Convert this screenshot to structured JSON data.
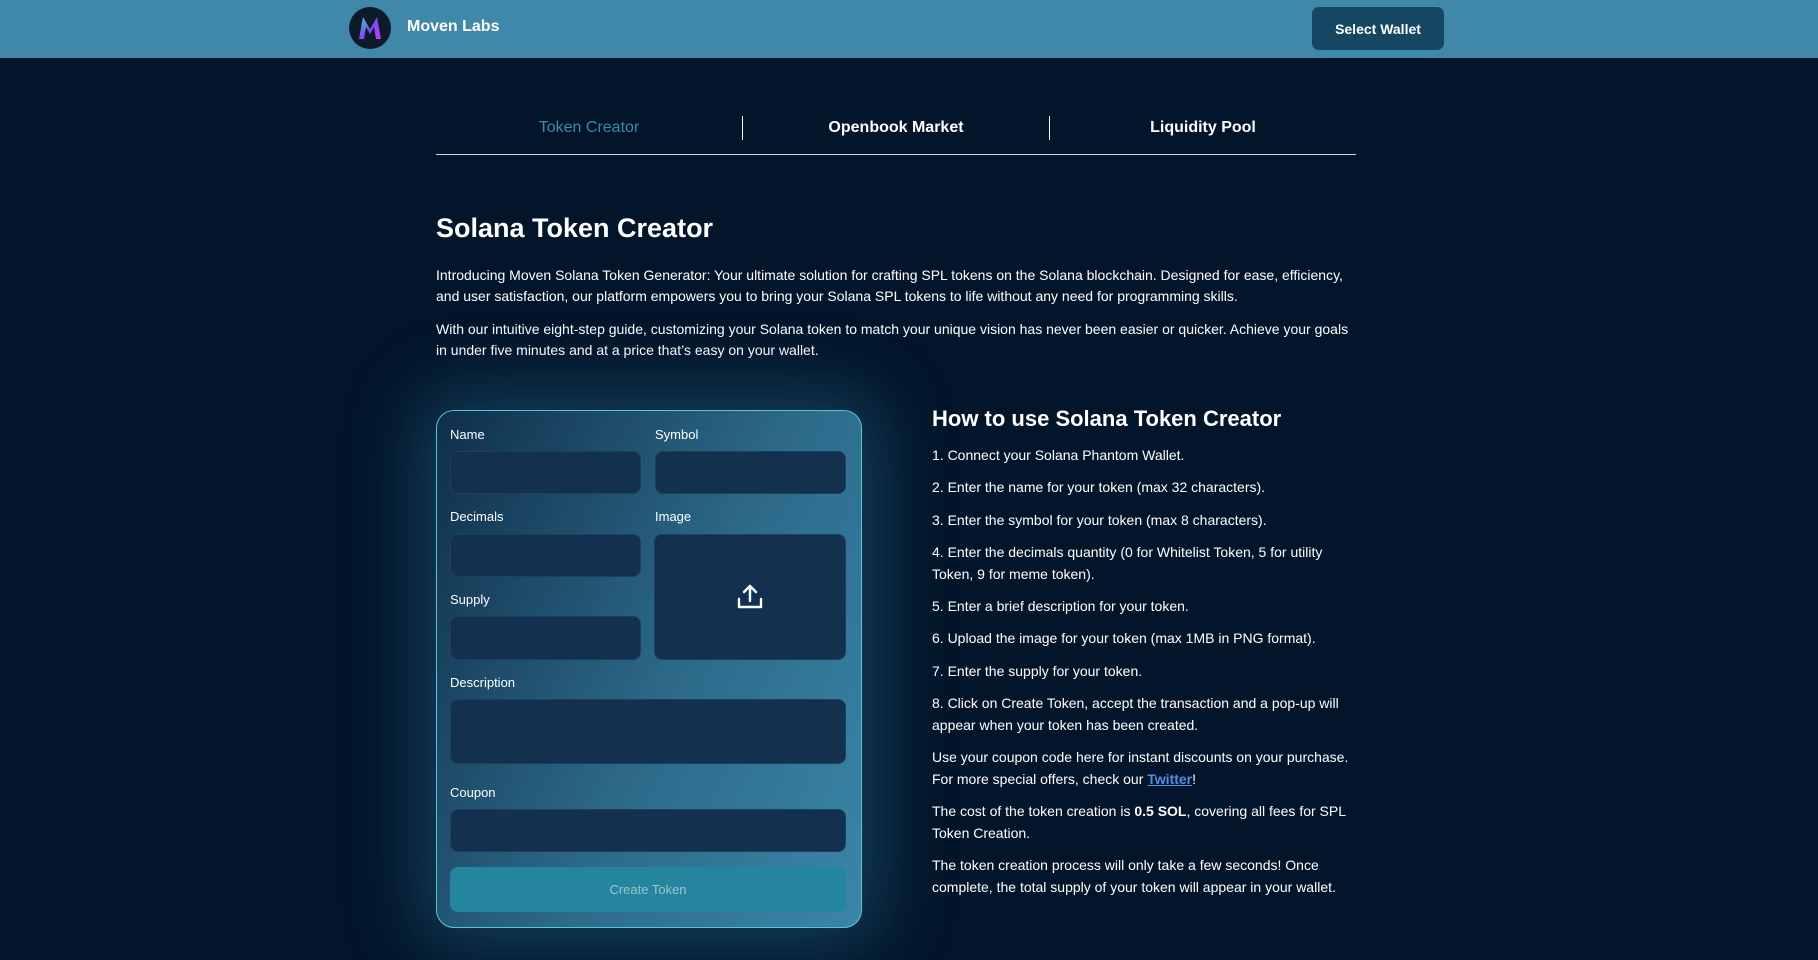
{
  "header": {
    "logo_letter": "M",
    "brand": "Moven Labs",
    "wallet_button": "Select Wallet"
  },
  "tabs": [
    {
      "label": "Token Creator",
      "active": true
    },
    {
      "label": "Openbook Market",
      "active": false
    },
    {
      "label": "Liquidity Pool",
      "active": false
    }
  ],
  "intro": {
    "title": "Solana Token Creator",
    "p1": "Introducing Moven Solana Token Generator: Your ultimate solution for crafting SPL tokens on the Solana blockchain. Designed for ease, efficiency, and user satisfaction, our platform empowers you to bring your Solana SPL tokens to life without any need for programming skills.",
    "p2": "With our intuitive eight-step guide, customizing your Solana token to match your unique vision has never been easier or quicker. Achieve your goals in under five minutes and at a price that’s easy on your wallet."
  },
  "form": {
    "name_label": "Name",
    "name_value": "",
    "symbol_label": "Symbol",
    "symbol_value": "",
    "decimals_label": "Decimals",
    "decimals_value": "",
    "image_label": "Image",
    "supply_label": "Supply",
    "supply_value": "",
    "description_label": "Description",
    "description_value": "",
    "coupon_label": "Coupon",
    "coupon_value": "",
    "create_button": "Create Token",
    "upload_icon": "upload-icon"
  },
  "howto": {
    "title": "How to use Solana Token Creator",
    "steps": [
      "1. Connect your Solana Phantom Wallet.",
      "2. Enter the name for your token (max 32 characters).",
      "3. Enter the symbol for your token (max 8 characters).",
      "4. Enter the decimals quantity (0 for Whitelist Token, 5 for utility Token, 9 for meme token).",
      "5. Enter a brief description for your token.",
      "6. Upload the image for your token (max 1MB in PNG format).",
      "7. Enter the supply for your token.",
      "8. Click on Create Token, accept the transaction and a pop-up will appear when your token has been created."
    ],
    "coupon_text": "Use your coupon code here for instant discounts on your purchase. For more special offers, check our ",
    "twitter_link": "Twitter",
    "coupon_end": "!",
    "cost_prefix": "The cost of the token creation is ",
    "cost_value": "0.5 SOL",
    "cost_suffix": ", covering all fees for SPL Token Creation.",
    "process_text": "The token creation process will only take a few seconds! Once complete, the total supply of your token will appear in your wallet."
  },
  "colors": {
    "background": "#03152b",
    "header": "#3f88aa",
    "accent": "#3f88aa",
    "link": "#4f8ee6",
    "button": "#23859e"
  }
}
